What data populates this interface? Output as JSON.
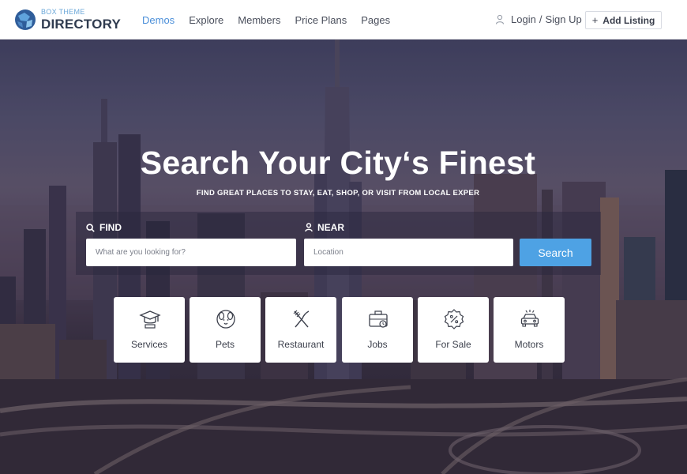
{
  "brand": {
    "top": "BOX THEME",
    "bottom": "DIRECTORY"
  },
  "nav": {
    "items": [
      {
        "label": "Demos"
      },
      {
        "label": "Explore"
      },
      {
        "label": "Members"
      },
      {
        "label": "Price Plans"
      },
      {
        "label": "Pages"
      }
    ]
  },
  "account": {
    "login": "Login",
    "separator": "/",
    "signup": "Sign Up",
    "add_listing": "Add Listing",
    "add_icon": "+"
  },
  "hero": {
    "title": "Search Your City‘s Finest",
    "subtitle": "FIND GREAT PLACES TO STAY, EAT, SHOP, OR VISIT FROM LOCAL EXPER"
  },
  "search": {
    "find_label": "FIND",
    "find_placeholder": "What are you looking for?",
    "near_label": "NEAR",
    "near_placeholder": "Location",
    "button": "Search"
  },
  "categories": [
    {
      "label": "Services",
      "icon": "graduation-cap-icon"
    },
    {
      "label": "Pets",
      "icon": "pet-icon"
    },
    {
      "label": "Restaurant",
      "icon": "fork-knife-icon"
    },
    {
      "label": "Jobs",
      "icon": "briefcase-icon"
    },
    {
      "label": "For Sale",
      "icon": "percent-badge-icon"
    },
    {
      "label": "Motors",
      "icon": "car-icon"
    }
  ],
  "colors": {
    "accent": "#4b8fd9",
    "search_button": "#4ea2e4",
    "header_bg": "#ffffff"
  }
}
